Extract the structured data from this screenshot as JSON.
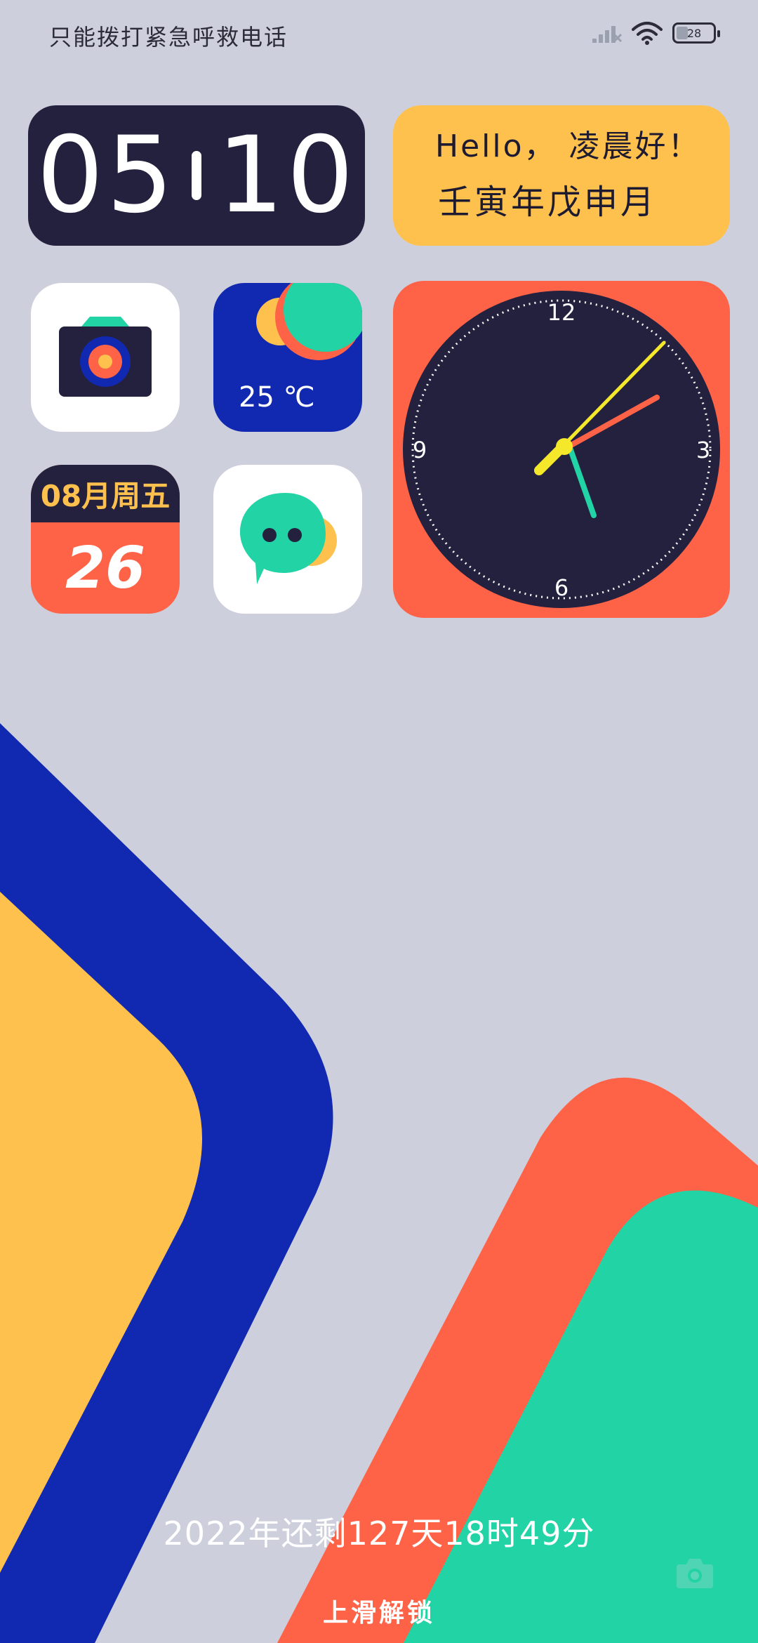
{
  "status_bar": {
    "carrier_text": "只能拨打紧急呼救电话",
    "battery_level": "28",
    "icons": [
      "signal-no-service-icon",
      "wifi-icon",
      "battery-icon"
    ]
  },
  "widgets": {
    "digital_clock": {
      "hours": "05",
      "minutes": "10"
    },
    "greeting": {
      "line1": "Hello， 凌晨好！",
      "line2": "壬寅年戊申月"
    },
    "weather": {
      "temperature": "25 ℃"
    },
    "calendar": {
      "header": "08月周五",
      "day": "26"
    },
    "analog_clock": {
      "labels": {
        "n12": "12",
        "n3": "3",
        "n6": "6",
        "n9": "9"
      }
    }
  },
  "apps": [
    {
      "name": "camera-app-icon"
    },
    {
      "name": "weather-app-icon"
    },
    {
      "name": "calendar-app-icon"
    },
    {
      "name": "messages-app-icon"
    }
  ],
  "lock_screen": {
    "countdown": "2022年还剩127天18时49分",
    "unlock_hint": "上滑解锁",
    "left_shortcut": "assistant-icon",
    "right_shortcut": "camera-shortcut-icon"
  },
  "colors": {
    "background": "#cdd0dc",
    "navy": "#24213f",
    "blue": "#1128b0",
    "yellow": "#ffc14d",
    "coral": "#ff6347",
    "teal": "#22d3a5"
  }
}
